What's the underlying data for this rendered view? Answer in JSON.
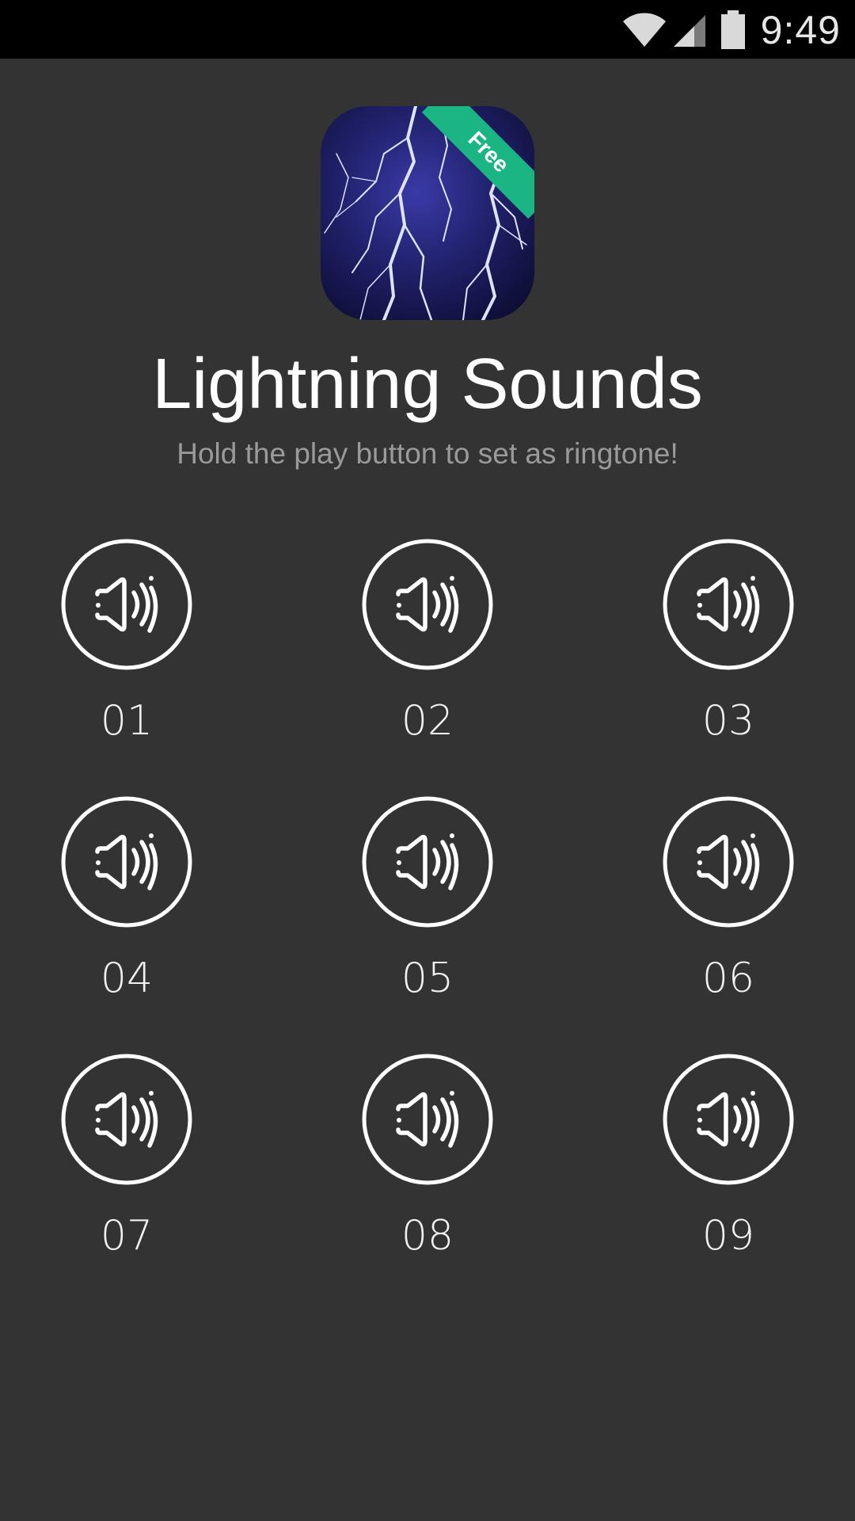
{
  "status_bar": {
    "time": "9:49"
  },
  "app": {
    "title": "Lightning Sounds",
    "subtitle": "Hold the play button to set as ringtone!",
    "badge": "Free",
    "badge_color": "#1bb584"
  },
  "sounds": [
    {
      "label": "01",
      "icon": "speaker-icon"
    },
    {
      "label": "02",
      "icon": "speaker-icon"
    },
    {
      "label": "03",
      "icon": "speaker-icon"
    },
    {
      "label": "04",
      "icon": "speaker-icon"
    },
    {
      "label": "05",
      "icon": "speaker-icon"
    },
    {
      "label": "06",
      "icon": "speaker-icon"
    },
    {
      "label": "07",
      "icon": "speaker-icon"
    },
    {
      "label": "08",
      "icon": "speaker-icon"
    },
    {
      "label": "09",
      "icon": "speaker-icon"
    }
  ]
}
